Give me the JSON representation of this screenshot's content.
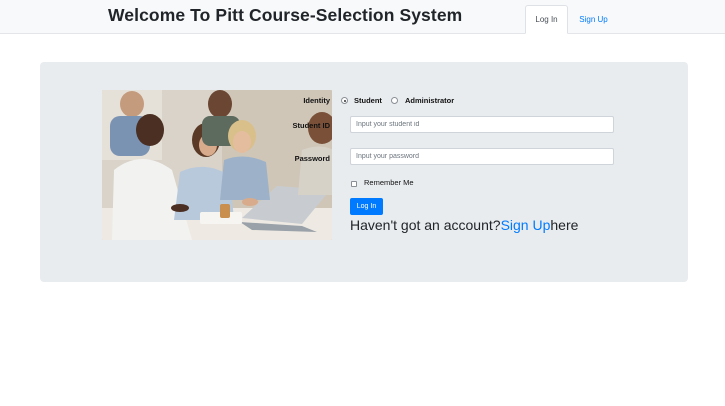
{
  "header": {
    "title": "Welcome To Pitt Course-Selection System",
    "tabs": [
      {
        "label": "Log In",
        "active": true
      },
      {
        "label": "Sign Up",
        "active": false
      }
    ]
  },
  "form": {
    "identity_label": "Identity",
    "identity_options": [
      {
        "label": "Student",
        "selected": true
      },
      {
        "label": "Administrator",
        "selected": false
      }
    ],
    "student_id_label": "Student ID",
    "student_id_placeholder": "Input your student id",
    "student_id_value": "",
    "password_label": "Password",
    "password_placeholder": "Input your password",
    "password_value": "",
    "remember_me_label": "Remember Me",
    "remember_me_checked": false,
    "login_button_label": "Log In",
    "signup_prefix": "Haven't got an account?",
    "signup_link": "Sign Up",
    "signup_suffix": "here"
  },
  "colors": {
    "accent": "#007bff",
    "panel_bg": "#e9ecef",
    "header_bg": "#f8f9fa"
  },
  "icons": {
    "hero_image": "team-meeting-photo"
  }
}
